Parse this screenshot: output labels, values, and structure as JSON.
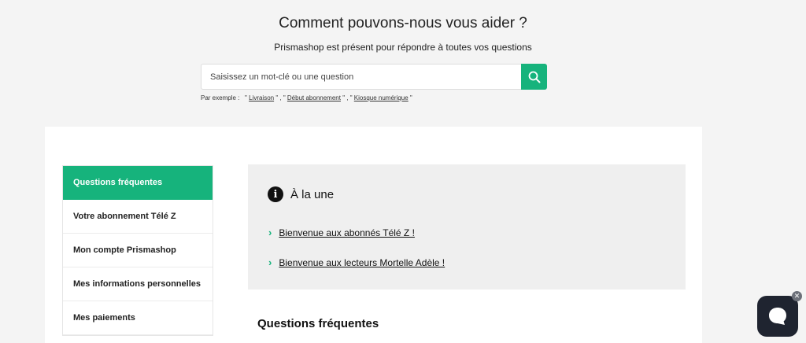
{
  "hero": {
    "title": "Comment pouvons-nous vous aider ?",
    "subtitle": "Prismashop est présent pour répondre à toutes vos questions"
  },
  "search": {
    "placeholder": "Saisissez un mot-clé ou une question",
    "button_icon": "search-icon",
    "examples_prefix": "Par exemple :",
    "examples": [
      "Livraison",
      "Début abonnement",
      "Kiosque numérique"
    ]
  },
  "sidebar": {
    "items": [
      {
        "label": "Questions fréquentes",
        "active": true
      },
      {
        "label": "Votre abonnement Télé Z",
        "active": false
      },
      {
        "label": "Mon compte Prismashop",
        "active": false
      },
      {
        "label": "Mes informations personnelles",
        "active": false
      },
      {
        "label": "Mes paiements",
        "active": false
      }
    ]
  },
  "news": {
    "icon": "info-icon",
    "title": "À la une",
    "links": [
      "Bienvenue aux abonnés Télé Z !",
      "Bienvenue aux lecteurs Mortelle Adèle !"
    ]
  },
  "faq": {
    "title": "Questions fréquentes"
  },
  "chat": {
    "icon": "chat-bubble-icon",
    "close_icon": "close-icon"
  },
  "colors": {
    "accent": "#16b37c",
    "page_bg": "#f4f4f4",
    "panel_bg": "#efefef",
    "chat_bg": "#1f2430"
  }
}
